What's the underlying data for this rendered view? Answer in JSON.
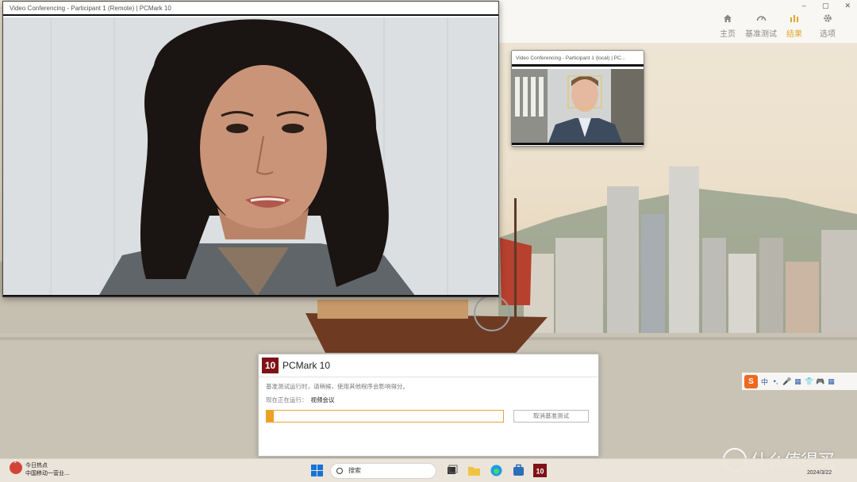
{
  "app": {
    "window_controls": [
      "–",
      "▢",
      "✕"
    ],
    "nav": [
      {
        "label": "主页",
        "icon": "home-icon"
      },
      {
        "label": "基准测试",
        "icon": "benchmark-icon"
      },
      {
        "label": "结果",
        "icon": "results-icon",
        "active": true
      },
      {
        "label": "选项",
        "icon": "gear-icon"
      }
    ],
    "accent_color": "#e0a52a"
  },
  "remote_window": {
    "title": "Video Conferencing - Participant 1 (Remote) | PCMark 10"
  },
  "local_window": {
    "title": "Video Conferencing - Participant 1 (local) | PC..."
  },
  "dialog": {
    "logo_text": "10",
    "title": "PCMark 10",
    "message": "基准测试运行时，请稍候，使用其他程序会影响得分。",
    "running_label": "现在正在运行：",
    "running_value": "视频会议",
    "progress": 0.03,
    "cancel_label": "取消基准测试"
  },
  "ime": {
    "logo": "S",
    "items": [
      "中",
      "•,",
      "🎤",
      "▦",
      "👕",
      "🎮",
      "▦"
    ]
  },
  "taskbar": {
    "news_title": "今日热点",
    "news_sub": "中国移动一营业...",
    "news_badge": "1",
    "search_placeholder": "搜索",
    "date": "2024/3/22"
  },
  "watermark": "什么值得买"
}
